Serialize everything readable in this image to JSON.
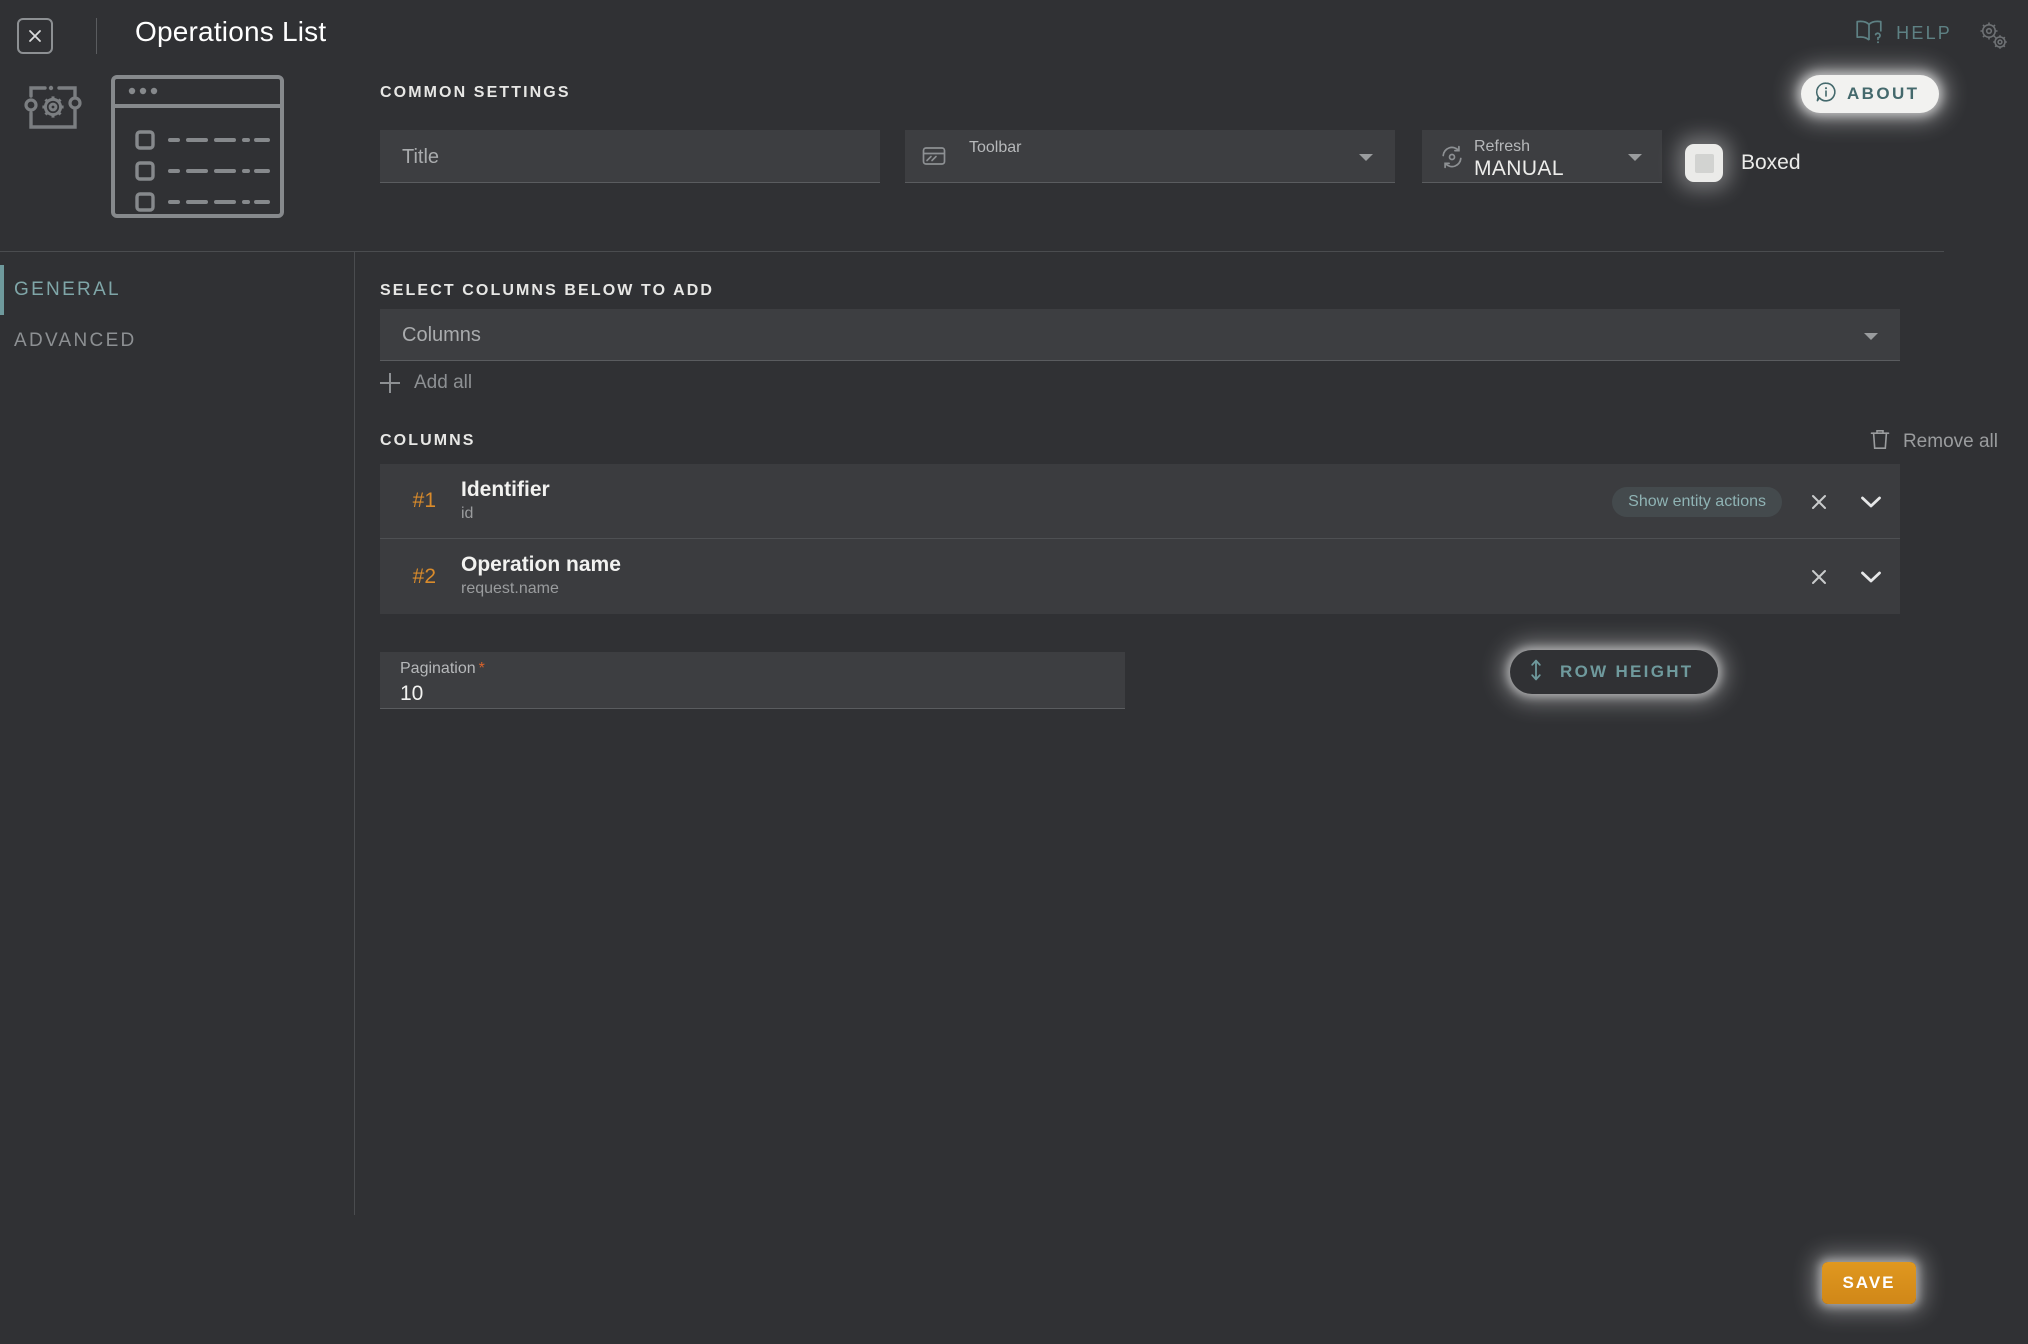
{
  "window": {
    "title": "Operations List",
    "close_icon": "close-box-icon"
  },
  "header": {
    "help_label": "HELP",
    "help_icon": "book-question-icon",
    "settings_icon": "gears-icon",
    "about_label": "ABOUT",
    "about_icon": "info-circle-icon"
  },
  "illustration": {
    "widget_icon": "widget-gear-icon",
    "preview_icon": "list-window-preview-icon"
  },
  "common_settings": {
    "section_label": "COMMON SETTINGS",
    "title_field": {
      "placeholder": "Title",
      "value": ""
    },
    "toolbar_field": {
      "placeholder": "Toolbar",
      "icon": "toolbar-icon",
      "value": ""
    },
    "refresh_field": {
      "label": "Refresh",
      "value": "MANUAL",
      "icon": "refresh-icon"
    },
    "boxed": {
      "label": "Boxed",
      "checked": true
    }
  },
  "sidebar": {
    "tabs": [
      {
        "label": "GENERAL",
        "active": true
      },
      {
        "label": "ADVANCED",
        "active": false
      }
    ]
  },
  "main": {
    "select_columns_label": "SELECT COLUMNS BELOW TO ADD",
    "columns_select": {
      "placeholder": "Columns",
      "value": ""
    },
    "add_all_label": "Add all",
    "add_all_icon": "plus-icon",
    "columns_label": "COLUMNS",
    "remove_all_label": "Remove all",
    "remove_all_icon": "trash-icon",
    "columns": [
      {
        "index": "#1",
        "title": "Identifier",
        "subtitle": "id",
        "chip": "Show entity actions",
        "remove_icon": "close-icon",
        "expand_icon": "chevron-down-icon"
      },
      {
        "index": "#2",
        "title": "Operation name",
        "subtitle": "request.name",
        "chip": "",
        "remove_icon": "close-icon",
        "expand_icon": "chevron-down-icon"
      }
    ],
    "pagination": {
      "label": "Pagination",
      "required_marker": "*",
      "value": "10"
    },
    "row_height_button": {
      "label": "ROW HEIGHT",
      "icon": "arrows-vertical-icon"
    }
  },
  "footer": {
    "save_label": "SAVE"
  },
  "colors": {
    "background": "#303134",
    "field": "#3d3e41",
    "accent_teal": "#6f9a9d",
    "accent_orange": "#d98b2b",
    "save_orange": "#e0981f",
    "required_red": "#d9622b"
  }
}
